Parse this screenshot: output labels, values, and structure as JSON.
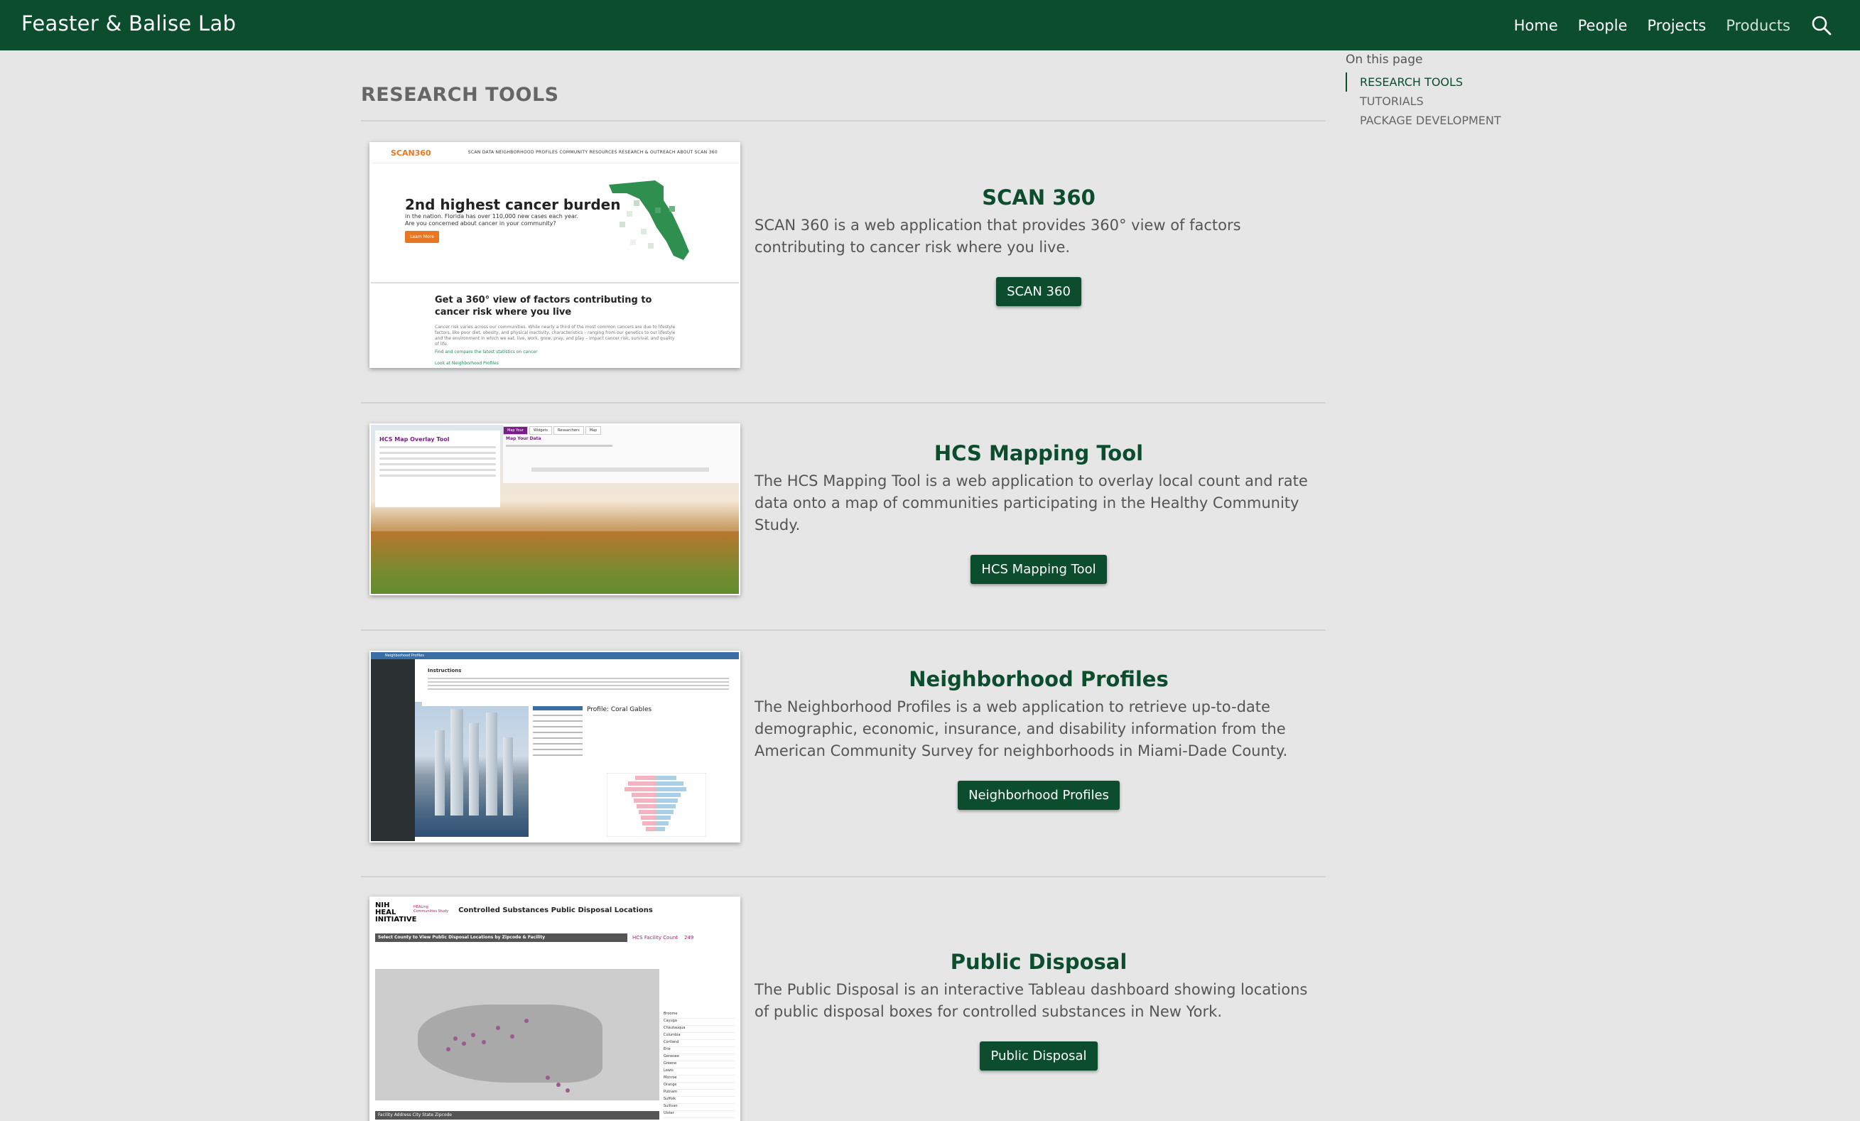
{
  "navbar": {
    "brand": "Feaster & Balise Lab",
    "links": [
      "Home",
      "People",
      "Projects",
      "Products"
    ],
    "search_icon": "search-icon",
    "background": "#0b4d2d"
  },
  "toc": {
    "title": "On this page",
    "items": [
      "RESEARCH TOOLS",
      "TUTORIALS",
      "PACKAGE DEVELOPMENT"
    ],
    "active": "RESEARCH TOOLS"
  },
  "section": {
    "title": "RESEARCH TOOLS"
  },
  "tools": [
    {
      "title": "SCAN 360",
      "description": "SCAN 360 is a web application that provides 360° view of factors contributing to cancer risk where you live.",
      "button": "SCAN 360",
      "thumb": {
        "logo": "SCAN360",
        "nav": "SCAN DATA   NEIGHBORHOOD PROFILES   COMMUNITY RESOURCES   RESEARCH & OUTREACH   ABOUT SCAN 360",
        "headline": "2nd highest cancer burden",
        "subtext": "in the nation. Florida has over 110,000 new cases each year. Are you concerned about cancer in your community?",
        "cta": "Learn More",
        "heading2": "Get a 360° view of factors contributing to cancer risk where you live",
        "body": "Cancer risk varies across our communities. While nearly a third of the most common cancers are due to lifestyle factors, like poor diet, obesity, and physical inactivity, characteristics – ranging from our genetics to our lifestyle and the environment in which we eat, live, work, grow, pray, and play – impact cancer risk, survival, and quality of life.",
        "link1": "Find and compare the latest statistics on cancer",
        "link2": "Look at Neighborhood Profiles"
      }
    },
    {
      "title": "HCS Mapping Tool",
      "description": "The HCS Mapping Tool is a web application to overlay local count and rate data onto a map of communities participating in the Healthy Community Study.",
      "button": "HCS Mapping Tool",
      "thumb": {
        "panel_title": "HCS Map Overlay Tool",
        "tabs": [
          "Map Your",
          "Widgets",
          "Researchers",
          "Map"
        ],
        "header": "Map Your Data"
      }
    },
    {
      "title": "Neighborhood Profiles",
      "description": "The Neighborhood Profiles is a web application to retrieve up-to-date demographic, economic, insurance, and disability information from the American Community Survey for neighborhoods in Miami-Dade County.",
      "button": "Neighborhood Profiles",
      "thumb": {
        "bar": "Neighborhood Profiles",
        "instructions": "Instructions",
        "profile": "Profile: Coral Gables"
      }
    },
    {
      "title": "Public Disposal",
      "description": "The Public Disposal is an interactive Tableau dashboard showing locations of public disposal boxes for controlled substances in New York.",
      "button": "Public Disposal",
      "thumb": {
        "org": "NIH HEAL INITIATIVE",
        "org2": "HEALing Communities Study",
        "title": "Controlled Substances Public Disposal Locations",
        "select": "Select County to View Public Disposal Locations by Zipcode & Facility",
        "count_label": "HCS Facility Count",
        "count": "249",
        "counties": [
          "Broome",
          "Cayuga",
          "Chautauqua",
          "Columbia",
          "Cortland",
          "Erie",
          "Genesee",
          "Greene",
          "Lewis",
          "Monroe",
          "Orange",
          "Putnam",
          "Suffolk",
          "Sullivan",
          "Ulster"
        ],
        "table_header": "Facility      Address           City        State   Zipcode"
      }
    }
  ]
}
